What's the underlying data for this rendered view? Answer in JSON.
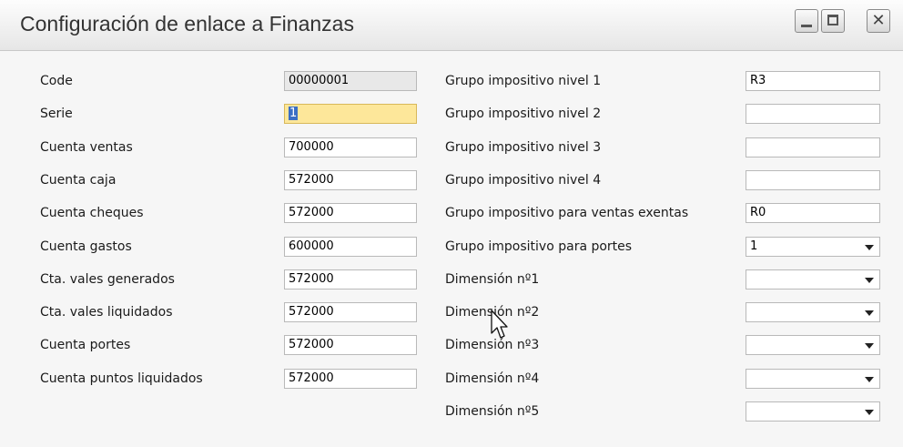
{
  "window": {
    "title": "Configuración de enlace a Finanzas"
  },
  "left_fields": [
    {
      "label": "Code",
      "value": "00000001",
      "readonly": true
    },
    {
      "label": "Serie",
      "value": "1",
      "active": true
    },
    {
      "label": "Cuenta ventas",
      "value": "700000"
    },
    {
      "label": "Cuenta caja",
      "value": "572000"
    },
    {
      "label": "Cuenta cheques",
      "value": "572000"
    },
    {
      "label": "Cuenta gastos",
      "value": "600000"
    },
    {
      "label": "Cta. vales generados",
      "value": "572000"
    },
    {
      "label": "Cta. vales liquidados",
      "value": "572000"
    },
    {
      "label": "Cuenta portes",
      "value": "572000"
    },
    {
      "label": "Cuenta puntos liquidados",
      "value": "572000"
    }
  ],
  "right_fields": [
    {
      "label": "Grupo impositivo nivel 1",
      "value": "R3",
      "type": "text"
    },
    {
      "label": "Grupo impositivo nivel 2",
      "value": "",
      "type": "text"
    },
    {
      "label": "Grupo impositivo nivel 3",
      "value": "",
      "type": "text"
    },
    {
      "label": "Grupo impositivo nivel 4",
      "value": "",
      "type": "text"
    },
    {
      "label": "Grupo impositivo para ventas exentas",
      "value": "R0",
      "type": "text"
    },
    {
      "label": "Grupo impositivo para portes",
      "value": "1",
      "type": "select"
    },
    {
      "label": "Dimensión nº1",
      "value": "",
      "type": "select"
    },
    {
      "label": "Dimensión nº2",
      "value": "",
      "type": "select"
    },
    {
      "label": "Dimensión nº3",
      "value": "",
      "type": "select"
    },
    {
      "label": "Dimensión nº4",
      "value": "",
      "type": "select"
    },
    {
      "label": "Dimensión nº5",
      "value": "",
      "type": "select"
    }
  ],
  "icons": {
    "minimize": "minimize-icon",
    "maximize": "maximize-icon",
    "close": "close-icon",
    "pointer": "mouse-pointer-icon"
  },
  "colors": {
    "active_field": "#fde79a",
    "readonly_field": "#e8e8e8",
    "selection": "#3b6ec4"
  }
}
